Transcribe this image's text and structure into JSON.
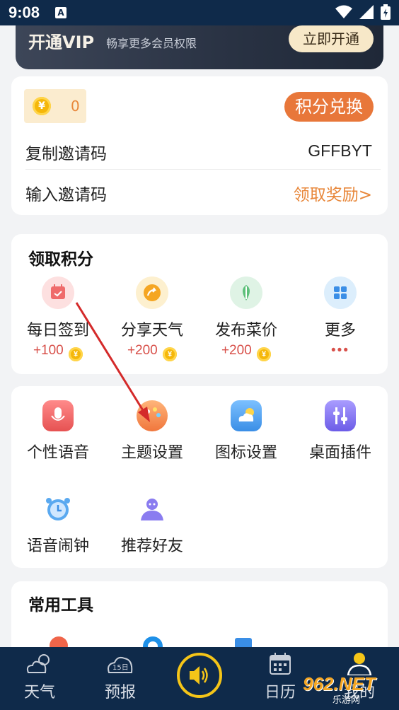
{
  "status": {
    "time": "9:08",
    "notify": "A"
  },
  "vip": {
    "title": "开通VIP",
    "subtitle": "畅享更多会员权限",
    "button": "立即开通"
  },
  "account": {
    "coins": "0",
    "coin_symbol": "¥",
    "exchange_button": "积分兑换",
    "copy_invite_label": "复制邀请码",
    "invite_code": "GFFBYT",
    "enter_invite_label": "输入邀请码",
    "reward_link": "领取奖励>"
  },
  "points_section": {
    "title": "领取积分",
    "items": [
      {
        "label": "每日签到",
        "points": "+100",
        "icon": "calendar-icon"
      },
      {
        "label": "分享天气",
        "points": "+200",
        "icon": "share-icon"
      },
      {
        "label": "发布菜价",
        "points": "+200",
        "icon": "vegetable-icon"
      },
      {
        "label": "更多",
        "points": "•••",
        "icon": "grid-icon"
      }
    ]
  },
  "tools_section": {
    "items": [
      {
        "label": "个性语音",
        "icon": "microphone-icon"
      },
      {
        "label": "主题设置",
        "icon": "palette-icon"
      },
      {
        "label": "图标设置",
        "icon": "weather-icon"
      },
      {
        "label": "桌面插件",
        "icon": "sliders-icon"
      },
      {
        "label": "语音闹钟",
        "icon": "alarm-clock-icon"
      },
      {
        "label": "推荐好友",
        "icon": "friend-icon"
      }
    ]
  },
  "common_tools": {
    "title": "常用工具"
  },
  "nav": {
    "items": [
      {
        "label": "天气",
        "icon": "cloud-sun-icon"
      },
      {
        "label": "预报",
        "icon": "forecast-icon",
        "badge": "15日"
      },
      {
        "label": "",
        "icon": "speaker-icon"
      },
      {
        "label": "日历",
        "icon": "calendar-icon"
      },
      {
        "label": "我的",
        "icon": "user-icon"
      }
    ]
  },
  "watermark": {
    "text": "962.NET",
    "sub": "乐游网"
  },
  "colors": {
    "accent": "#e8773a",
    "nav_bg": "#0f2a4a",
    "center_ring": "#f5c518"
  }
}
